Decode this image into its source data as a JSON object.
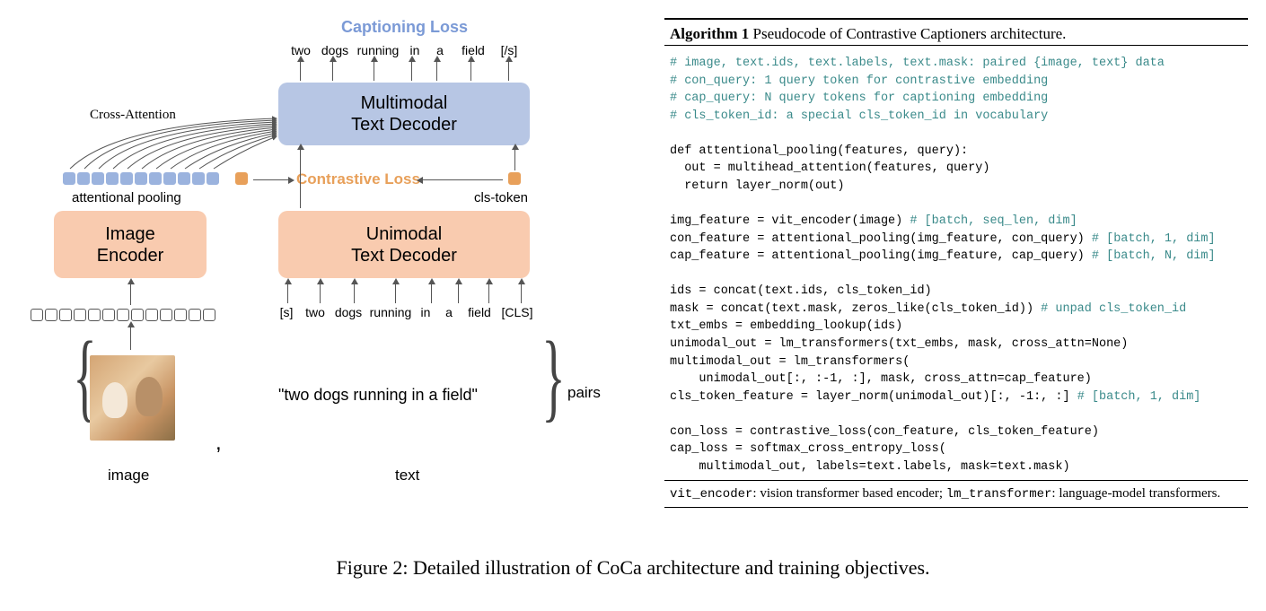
{
  "diagram": {
    "captioning_loss": "Captioning Loss",
    "contrastive_loss": "Contrastive Loss",
    "cross_attention": "Cross-Attention",
    "attentional_pooling": "attentional pooling",
    "cls_token": "cls-token",
    "multimodal_decoder": "Multimodal\nText Decoder",
    "unimodal_decoder": "Unimodal\nText Decoder",
    "image_encoder": "Image\nEncoder",
    "output_tokens": [
      "two",
      "dogs",
      "running",
      "in",
      "a",
      "field",
      "[/s]"
    ],
    "input_tokens": [
      "[s]",
      "two",
      "dogs",
      "running",
      "in",
      "a",
      "field",
      "[CLS]"
    ],
    "text_caption": "\"two dogs running in a field\"",
    "pairs_label": "pairs",
    "image_label": "image",
    "text_label": "text",
    "comma": ","
  },
  "algorithm": {
    "header_bold": "Algorithm 1",
    "header_rest": " Pseudocode of Contrastive Captioners architecture.",
    "comment1": "# image, text.ids, text.labels, text.mask: paired {image, text} data",
    "comment2": "# con_query: 1 query token for contrastive embedding",
    "comment3": "# cap_query: N query tokens for captioning embedding",
    "comment4": "# cls_token_id: a special cls_token_id in vocabulary",
    "line1": "def attentional_pooling(features, query):",
    "line2": "  out = multihead_attention(features, query)",
    "line3": "  return layer_norm(out)",
    "line4a": "img_feature = vit_encoder(image) ",
    "line4b": "# [batch, seq_len, dim]",
    "line5a": "con_feature = attentional_pooling(img_feature, con_query) ",
    "line5b": "# [batch, 1, dim]",
    "line6a": "cap_feature = attentional_pooling(img_feature, cap_query) ",
    "line6b": "# [batch, N, dim]",
    "line7": "ids = concat(text.ids, cls_token_id)",
    "line8a": "mask = concat(text.mask, zeros_like(cls_token_id)) ",
    "line8b": "# unpad cls_token_id",
    "line9": "txt_embs = embedding_lookup(ids)",
    "line10": "unimodal_out = lm_transformers(txt_embs, mask, cross_attn=None)",
    "line11": "multimodal_out = lm_transformers(",
    "line12": "    unimodal_out[:, :-1, :], mask, cross_attn=cap_feature)",
    "line13a": "cls_token_feature = layer_norm(unimodal_out)[:, -1:, :] ",
    "line13b": "# [batch, 1, dim]",
    "line14": "con_loss = contrastive_loss(con_feature, cls_token_feature)",
    "line15": "cap_loss = softmax_cross_entropy_loss(",
    "line16": "    multimodal_out, labels=text.labels, mask=text.mask)",
    "footer_vit": "vit_encoder",
    "footer_vit_desc": ": vision transformer based encoder; ",
    "footer_lm": "lm_transformer",
    "footer_lm_desc": ": language-model transformers."
  },
  "caption": "Figure 2: Detailed illustration of CoCa architecture and training objectives."
}
